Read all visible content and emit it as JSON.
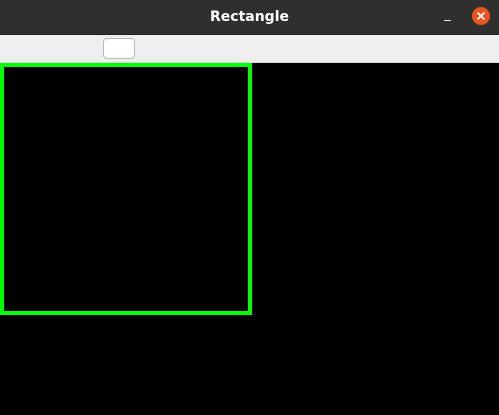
{
  "window": {
    "title": "Rectangle",
    "icons": {
      "minimize": "minimize-icon",
      "close": "close-icon"
    },
    "colors": {
      "titlebar": "#2f2f2f",
      "close_button": "#e95420",
      "toolbar": "#efefef",
      "canvas_background": "#000000"
    }
  },
  "toolbar": {
    "button_label": ""
  },
  "canvas": {
    "shape": "rectangle",
    "stroke_color": "#00ff00"
  }
}
